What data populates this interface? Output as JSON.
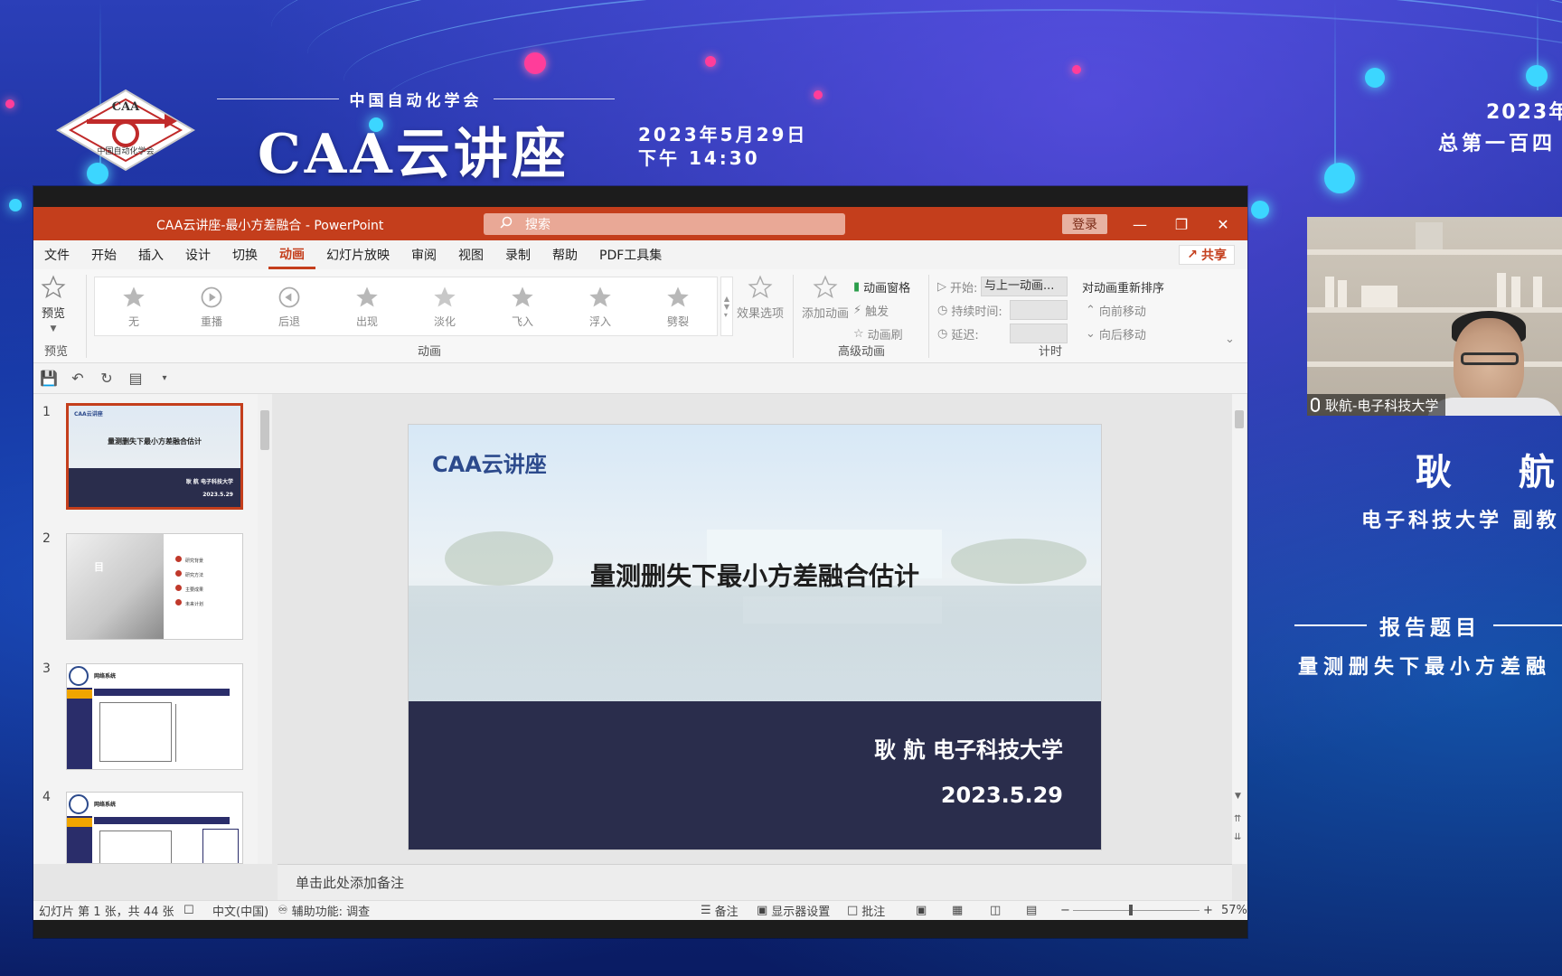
{
  "stream": {
    "logo_text": "CAA",
    "logo_ring_text": "中国自动化学会",
    "org_name": "中国自动化学会",
    "series_title": "CAA云讲座",
    "date": "2023年5月29日",
    "time": "下午 14:30",
    "year_right": "2023年",
    "series_count": "总第一百四",
    "colors": {
      "accent_cyan": "#3cd6ff",
      "accent_pink": "#ff3d9a",
      "background": "#13298f"
    }
  },
  "speaker": {
    "camera_label": "耿航-电子科技大学",
    "name": "耿 航",
    "affiliation": "电子科技大学 副教",
    "topic_heading": "报告题目",
    "topic": "量测删失下最小方差融"
  },
  "ppt": {
    "title": "CAA云讲座-最小方差融合 - PowerPoint",
    "search_placeholder": "搜索",
    "login": "登录",
    "share": "共享",
    "tabs": [
      "文件",
      "开始",
      "插入",
      "设计",
      "切换",
      "动画",
      "幻灯片放映",
      "审阅",
      "视图",
      "录制",
      "帮助",
      "PDF工具集"
    ],
    "active_tab": "动画",
    "ribbon": {
      "preview": "预览",
      "preview_group": "预览",
      "animations": [
        "无",
        "重播",
        "后退",
        "出现",
        "淡化",
        "飞入",
        "浮入",
        "劈裂"
      ],
      "effect_options": "效果选项",
      "animation_group": "动画",
      "add_animation": "添加动画",
      "animation_pane": "动画窗格",
      "trigger": "触发",
      "animation_painter": "动画刷",
      "advanced_group": "高级动画",
      "start_label": "开始:",
      "start_value": "与上一动画...",
      "duration_label": "持续时间:",
      "delay_label": "延迟:",
      "reorder": "对动画重新排序",
      "move_earlier": "向前移动",
      "move_later": "向后移动",
      "timing_group": "计时"
    },
    "thumbnails": [
      {
        "num": "1",
        "brand": "CAA云讲座",
        "title": "量测删失下最小方差融合估计",
        "author": "耿 航 电子科技大学",
        "date": "2023.5.29"
      },
      {
        "num": "2",
        "title": "目",
        "items": [
          "研究背景",
          "研究方法",
          "主要成果",
          "未来计划"
        ]
      },
      {
        "num": "3",
        "header": "网络系统"
      },
      {
        "num": "4",
        "header": "网络系统"
      }
    ],
    "slide": {
      "brand": "CAA云讲座",
      "title": "量测删失下最小方差融合估计",
      "author": "耿 航 电子科技大学",
      "date": "2023.5.29"
    },
    "notes_placeholder": "单击此处添加备注",
    "status": {
      "slide_info": "幻灯片 第 1 张，共 44 张",
      "language": "中文(中国)",
      "accessibility": "辅助功能: 调查",
      "notes": "备注",
      "display_settings": "显示器设置",
      "comments": "批注",
      "zoom": "57%"
    }
  }
}
